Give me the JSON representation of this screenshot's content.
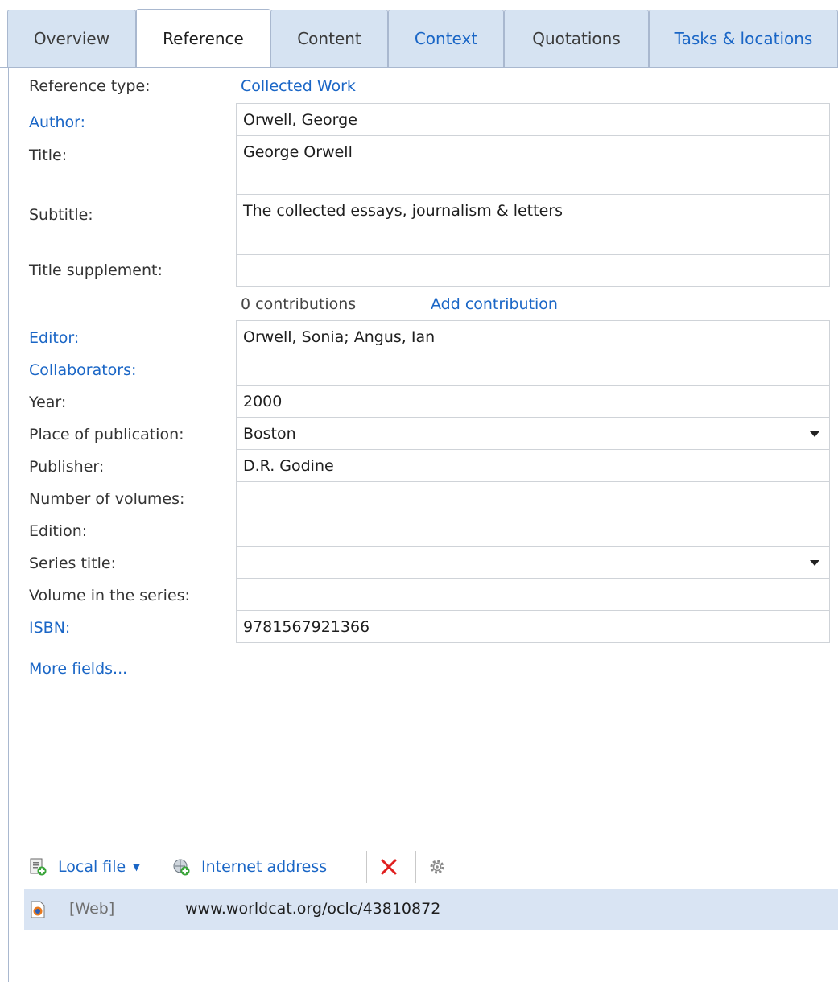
{
  "tabs": [
    {
      "label": "Overview",
      "active": false,
      "link": false
    },
    {
      "label": "Reference",
      "active": true,
      "link": false
    },
    {
      "label": "Content",
      "active": false,
      "link": false
    },
    {
      "label": "Context",
      "active": false,
      "link": true
    },
    {
      "label": "Quotations",
      "active": false,
      "link": false
    },
    {
      "label": "Tasks & locations",
      "active": false,
      "link": true
    }
  ],
  "reference_type": {
    "label": "Reference type:",
    "value": "Collected Work"
  },
  "fields": {
    "author": {
      "label": "Author:",
      "value": "Orwell, George"
    },
    "title": {
      "label": "Title:",
      "value": "George Orwell"
    },
    "subtitle": {
      "label": "Subtitle:",
      "value": "The collected essays, journalism & letters"
    },
    "title_supplement": {
      "label": "Title supplement:",
      "value": ""
    },
    "editor": {
      "label": "Editor:",
      "value": "Orwell, Sonia; Angus, Ian"
    },
    "collaborators": {
      "label": "Collaborators:",
      "value": ""
    },
    "year": {
      "label": "Year:",
      "value": "2000"
    },
    "place": {
      "label": "Place of publication:",
      "value": "Boston"
    },
    "publisher": {
      "label": "Publisher:",
      "value": "D.R. Godine"
    },
    "volumes": {
      "label": "Number of volumes:",
      "value": ""
    },
    "edition": {
      "label": "Edition:",
      "value": ""
    },
    "series_title": {
      "label": "Series title:",
      "value": ""
    },
    "volume_in_series": {
      "label": "Volume in the series:",
      "value": ""
    },
    "isbn": {
      "label": "ISBN:",
      "value": "9781567921366"
    }
  },
  "contributions": {
    "count": "0 contributions",
    "add": "Add contribution"
  },
  "more_fields": "More fields...",
  "attachments": {
    "local_file": "Local file",
    "internet_address": "Internet address",
    "items": [
      {
        "type": "[Web]",
        "url": "www.worldcat.org/oclc/43810872"
      }
    ]
  },
  "colors": {
    "link": "#1a66c6",
    "tab_bg": "#d6e3f2",
    "selected_row": "#d9e4f3",
    "delete_red": "#e02020"
  }
}
